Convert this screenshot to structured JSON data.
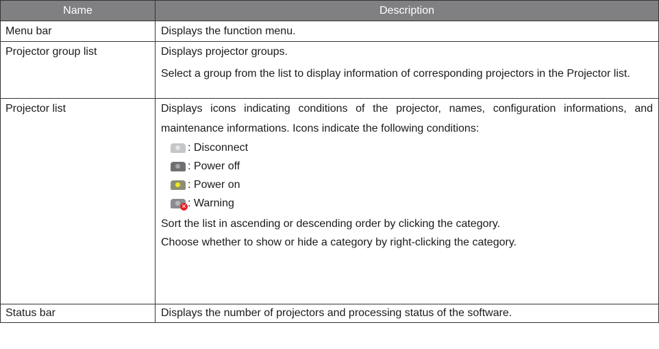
{
  "colors": {
    "header_bg": "#808083",
    "header_text": "#ffffff",
    "border": "#333333",
    "disconnect_icon": "#c4c6c8",
    "power_off_icon": "#6d6f72",
    "power_on_icon": "#8c8f74",
    "power_on_led": "#f1ea1c",
    "warning_badge": "#e31e24"
  },
  "table": {
    "header": {
      "name": "Name",
      "description": "Description"
    },
    "rows": [
      {
        "name": "Menu bar",
        "lines": [
          "Displays the function menu."
        ]
      },
      {
        "name": "Projector group list",
        "lines": [
          "Displays projector groups.",
          "Select a group from the list to display information of corresponding",
          "projectors in the Projector list."
        ]
      },
      {
        "name": "Projector list",
        "lines": [
          "Displays icons indicating conditions of the projector, names, configuration",
          "informations, and maintenance informations. Icons indicate the following",
          "conditions:"
        ],
        "conditions": [
          {
            "icon": "projector-disconnect-icon",
            "label": ": Disconnect"
          },
          {
            "icon": "projector-power-off-icon",
            "label": ": Power off"
          },
          {
            "icon": "projector-power-on-icon",
            "label": ": Power on"
          },
          {
            "icon": "projector-warning-icon",
            "label": ": Warning"
          }
        ],
        "after_lines": [
          "Sort the list in ascending or descending order by clicking the category.",
          "Choose whether to show or hide a category by right-clicking the category."
        ]
      },
      {
        "name": "Status bar",
        "lines": [
          "Displays the number of projectors and processing status of the software."
        ]
      }
    ]
  }
}
